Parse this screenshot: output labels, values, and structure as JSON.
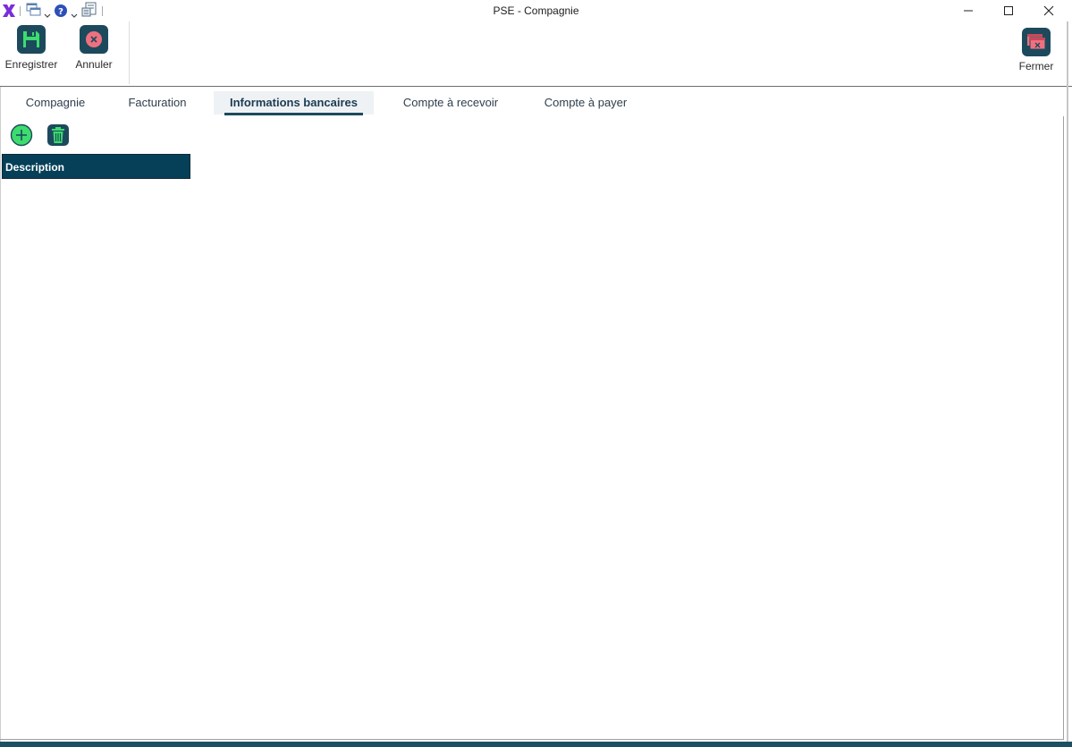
{
  "window": {
    "title": "PSE - Compagnie"
  },
  "quick_access": {
    "icons": [
      "app-logo-icon",
      "windows-icon",
      "help-icon",
      "report-icon"
    ]
  },
  "ribbon": {
    "save_label": "Enregistrer",
    "cancel_label": "Annuler",
    "close_label": "Fermer"
  },
  "tabs": [
    {
      "label": "Compagnie",
      "active": false
    },
    {
      "label": "Facturation",
      "active": false
    },
    {
      "label": "Informations bancaires",
      "active": true
    },
    {
      "label": "Compte à recevoir",
      "active": false
    },
    {
      "label": "Compte à payer",
      "active": false
    }
  ],
  "grid": {
    "columns": [
      "Description"
    ],
    "rows": []
  },
  "colors": {
    "accent": "#1c4a5c",
    "header_bg": "#054058",
    "logo_purple": "#7b2cd8",
    "add_green": "#3ddc6e",
    "cancel_red": "#f07080"
  }
}
